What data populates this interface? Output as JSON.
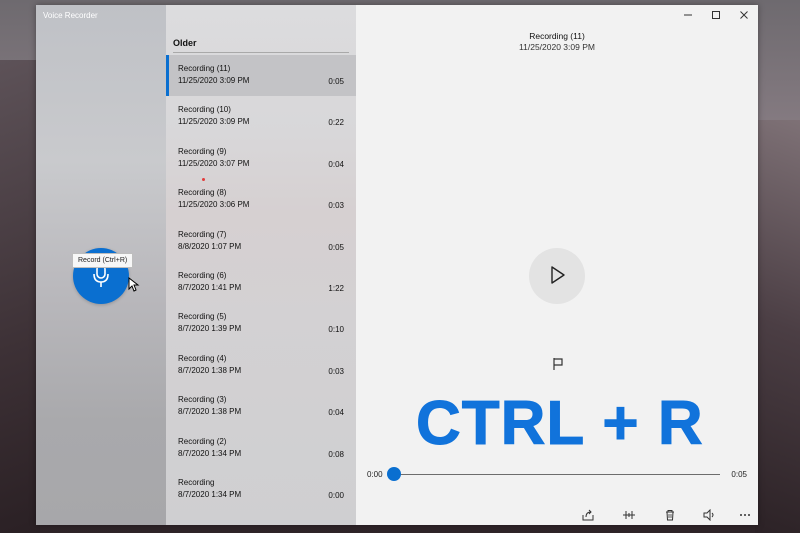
{
  "app": {
    "title": "Voice Recorder",
    "accent_color": "#0a6fd0"
  },
  "record_button": {
    "tooltip": "Record (Ctrl+R)",
    "icon": "microphone-icon"
  },
  "recordings_list": {
    "group_header": "Older",
    "items": [
      {
        "name": "Recording (11)",
        "date": "11/25/2020 3:09 PM",
        "duration": "0:05",
        "selected": true
      },
      {
        "name": "Recording (10)",
        "date": "11/25/2020 3:09 PM",
        "duration": "0:22"
      },
      {
        "name": "Recording (9)",
        "date": "11/25/2020 3:07 PM",
        "duration": "0:04"
      },
      {
        "name": "Recording (8)",
        "date": "11/25/2020 3:06 PM",
        "duration": "0:03"
      },
      {
        "name": "Recording (7)",
        "date": "8/8/2020 1:07 PM",
        "duration": "0:05"
      },
      {
        "name": "Recording (6)",
        "date": "8/7/2020 1:41 PM",
        "duration": "1:22"
      },
      {
        "name": "Recording (5)",
        "date": "8/7/2020 1:39 PM",
        "duration": "0:10"
      },
      {
        "name": "Recording (4)",
        "date": "8/7/2020 1:38 PM",
        "duration": "0:03"
      },
      {
        "name": "Recording (3)",
        "date": "8/7/2020 1:38 PM",
        "duration": "0:04"
      },
      {
        "name": "Recording (2)",
        "date": "8/7/2020 1:34 PM",
        "duration": "0:08"
      },
      {
        "name": "Recording",
        "date": "8/7/2020 1:34 PM",
        "duration": "0:00"
      }
    ]
  },
  "now_playing": {
    "title": "Recording (11)",
    "date": "11/25/2020 3:09 PM",
    "time_current": "0:00",
    "time_total": "0:05",
    "progress": 0
  },
  "overlay": {
    "text": "CTRL + R"
  },
  "toolbar": {
    "icons": [
      "share-icon",
      "trim-icon",
      "delete-icon",
      "speed-icon",
      "more-icon"
    ]
  }
}
